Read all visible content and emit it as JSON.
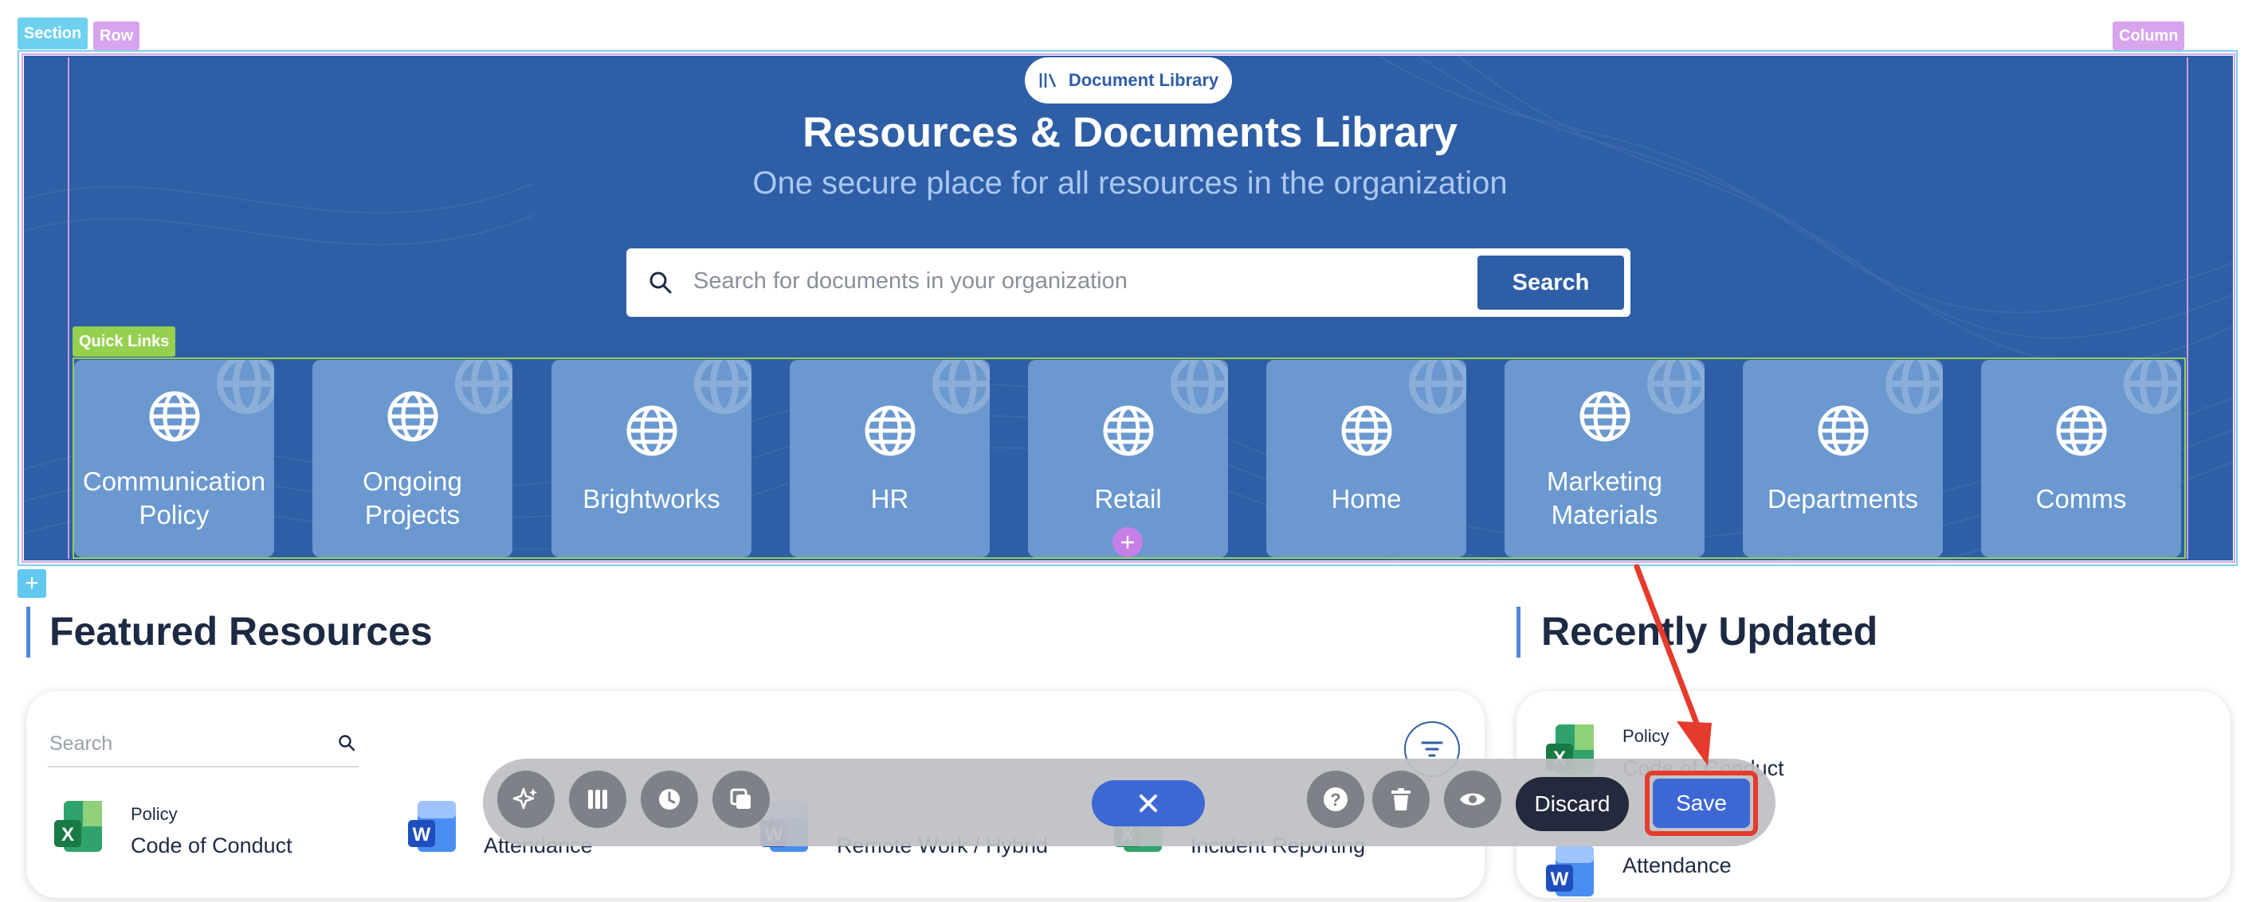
{
  "editor_tags": {
    "section": "Section",
    "row": "Row",
    "column": "Column",
    "quick_links": "Quick Links"
  },
  "hero": {
    "pill_label": "Document Library",
    "title": "Resources & Documents Library",
    "subtitle": "One secure place for all resources in the organization",
    "search_placeholder": "Search for documents in your organization",
    "search_button": "Search"
  },
  "quick_links": [
    {
      "line1": "Communication",
      "line2": "Policy"
    },
    {
      "line1": "Ongoing",
      "line2": "Projects"
    },
    {
      "line1": "Brightworks",
      "line2": ""
    },
    {
      "line1": "HR",
      "line2": ""
    },
    {
      "line1": "Retail",
      "line2": ""
    },
    {
      "line1": "Home",
      "line2": ""
    },
    {
      "line1": "Marketing",
      "line2": "Materials"
    },
    {
      "line1": "Departments",
      "line2": ""
    },
    {
      "line1": "Comms",
      "line2": ""
    }
  ],
  "add_symbol": "+",
  "featured": {
    "heading": "Featured Resources",
    "search_placeholder": "Search",
    "docs": [
      {
        "category": "Policy",
        "name": "Code of Conduct",
        "app": "excel"
      },
      {
        "category": "",
        "name": "Attendance",
        "app": "word"
      },
      {
        "category": "",
        "name": "Remote Work / Hybrid",
        "app": "word"
      },
      {
        "category": "",
        "name": "Incident Reporting",
        "app": "excel"
      }
    ]
  },
  "recent": {
    "heading": "Recently Updated",
    "docs": [
      {
        "category": "Policy",
        "name": "Code of Conduct",
        "app": "excel"
      },
      {
        "category": "",
        "name": "Attendance",
        "app": "word"
      }
    ]
  },
  "toolbar": {
    "icons": [
      "sparkle-icon",
      "columns-icon",
      "clock-icon",
      "copy-icon"
    ],
    "right_icons": [
      "help-icon",
      "trash-icon",
      "eye-icon"
    ],
    "discard": "Discard",
    "save": "Save"
  },
  "colors": {
    "hero_bg": "#2e5ea6",
    "card_bg": "#6a98cf",
    "primary": "#3d68d4",
    "annotation_red": "#e53b2c"
  }
}
